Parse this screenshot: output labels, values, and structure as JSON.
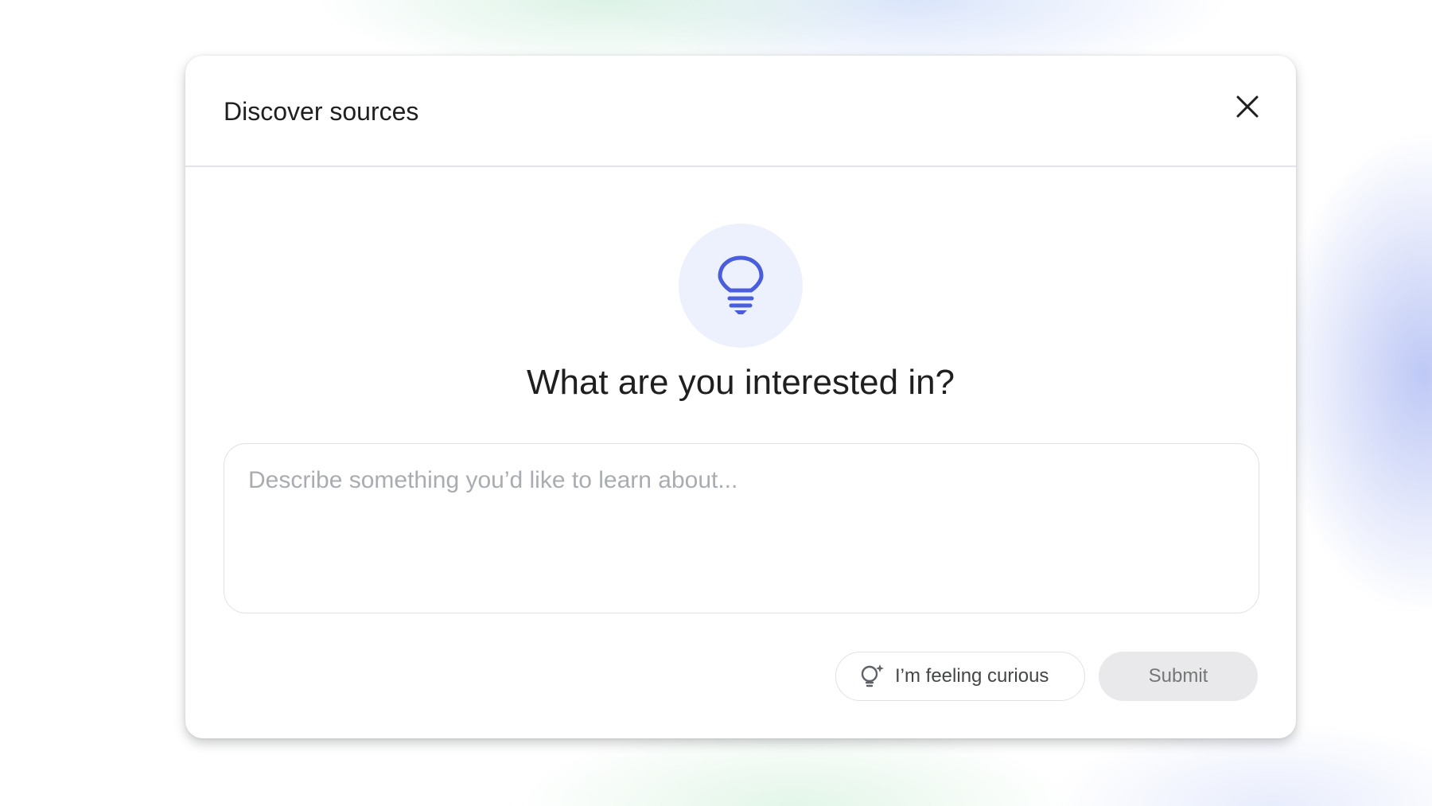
{
  "dialog": {
    "title": "Discover sources",
    "close_icon": "close-icon",
    "hero_icon": "lightbulb-icon",
    "heading": "What are you interested in?",
    "input": {
      "placeholder": "Describe something you’d like to learn about...",
      "value": ""
    },
    "curious_button": {
      "icon": "lightbulb-sparkle-icon",
      "label": "I’m feeling curious"
    },
    "submit_button": {
      "label": "Submit",
      "state": "disabled"
    }
  },
  "colors": {
    "accent": "#4a5ddb",
    "icon_circle": "#edf0fd",
    "title_text": "#1f1f1f",
    "placeholder_text": "#a9acb0",
    "submit_bg": "#e9e9eb",
    "submit_text": "#747775"
  }
}
